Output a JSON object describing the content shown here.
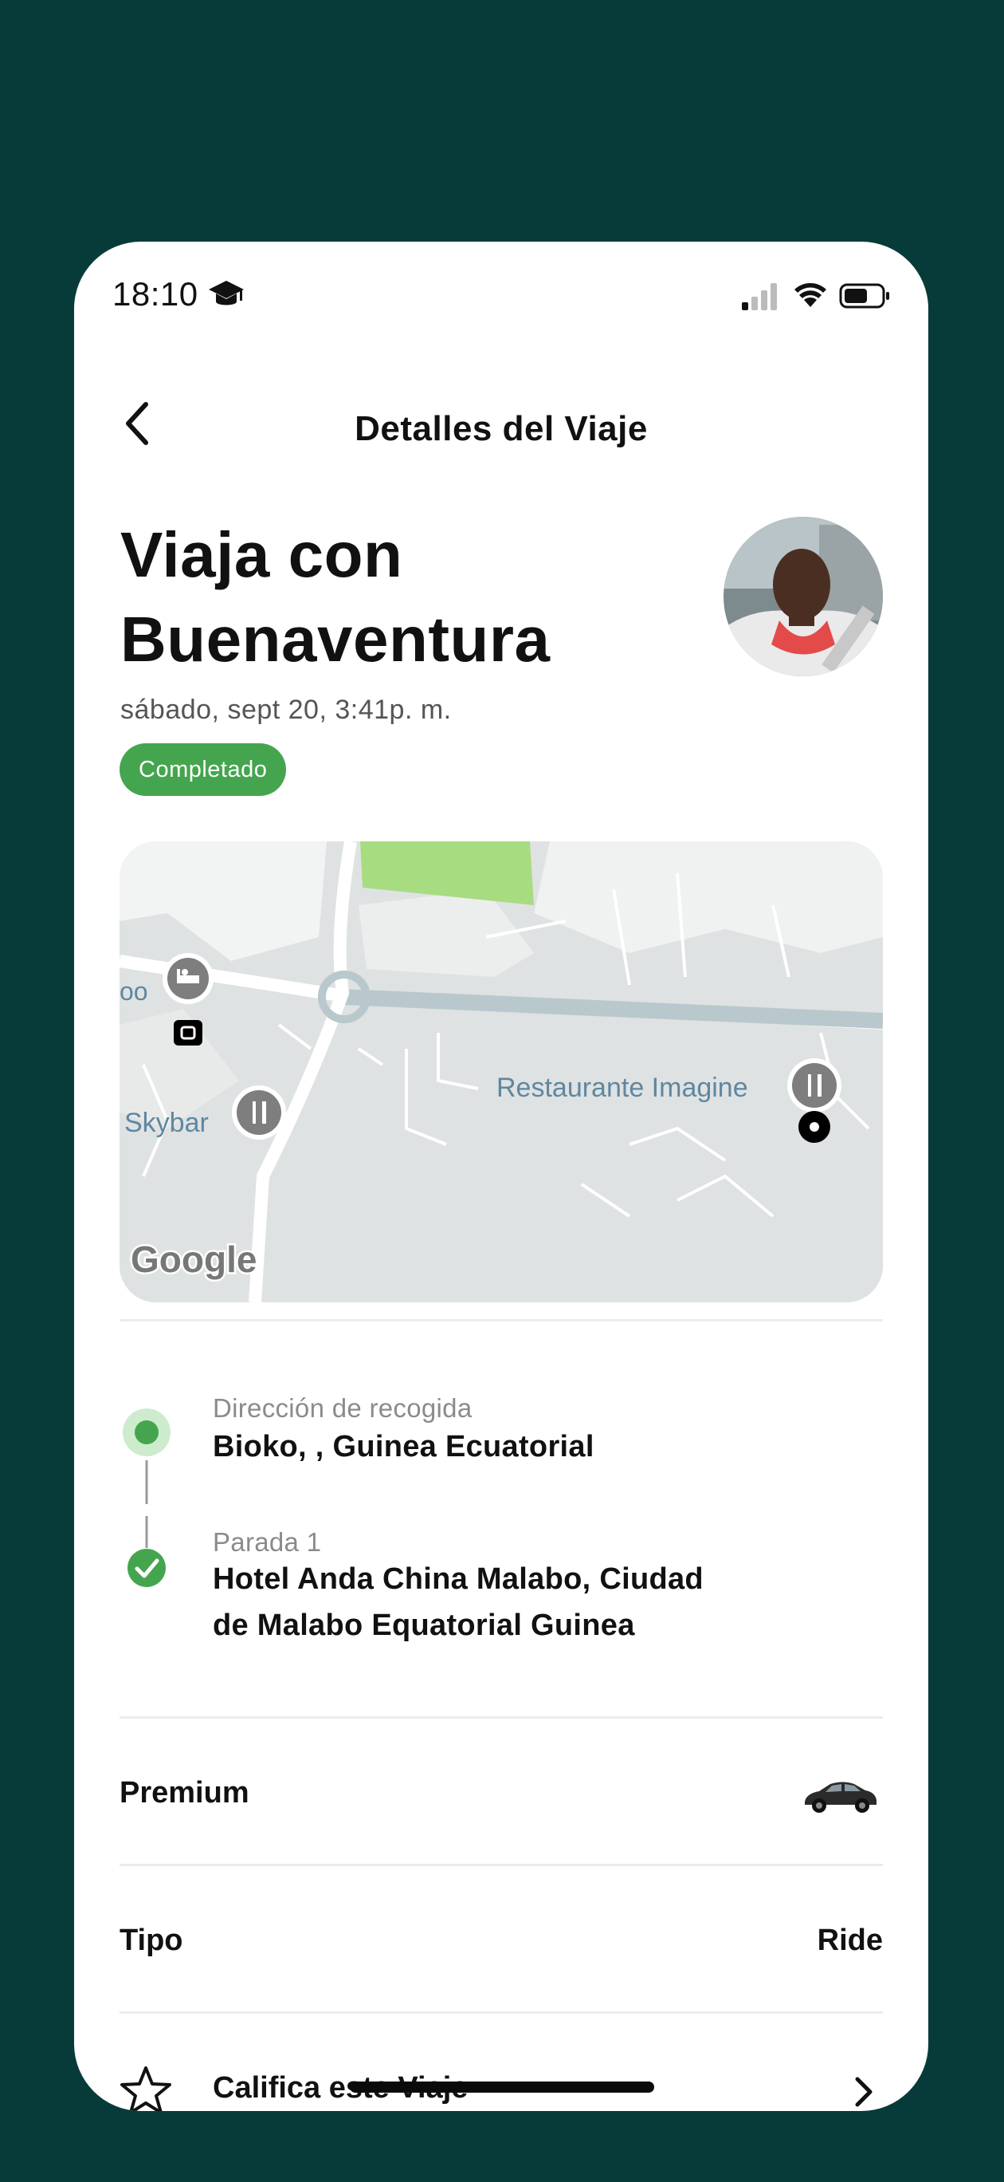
{
  "status": {
    "time": "18:10"
  },
  "nav": {
    "title": "Detalles del Viaje",
    "back": "back"
  },
  "trip": {
    "title_line1": "Viaja con",
    "title_line2": "Buenaventura",
    "date": "sábado, sept 20, 3:41p. m.",
    "status_badge": "Completado"
  },
  "map": {
    "labels": {
      "left_partial": "oo",
      "skybar": "Skybar",
      "restaurant": "Restaurante Imagine",
      "google": "Google"
    }
  },
  "route": {
    "pickup_label": "Dirección de recogida",
    "pickup_value": "Bioko, , Guinea Ecuatorial",
    "stop_label": "Parada 1",
    "stop_value_line1": "Hotel Anda China Malabo, Ciudad",
    "stop_value_line2": "de Malabo Equatorial Guinea"
  },
  "details": {
    "category_label": "Premium",
    "type_label": "Tipo",
    "type_value": "Ride",
    "rate_label": "Califica este Viaje"
  },
  "colors": {
    "accent_green": "#45a54f",
    "background": "#073b39"
  },
  "icons": [
    "graduation-cap-icon",
    "cellular-signal-icon",
    "wifi-icon",
    "battery-icon",
    "back-chevron-icon",
    "hotel-icon",
    "restaurant-icon",
    "check-icon",
    "car-icon",
    "star-icon",
    "chevron-right-icon"
  ]
}
